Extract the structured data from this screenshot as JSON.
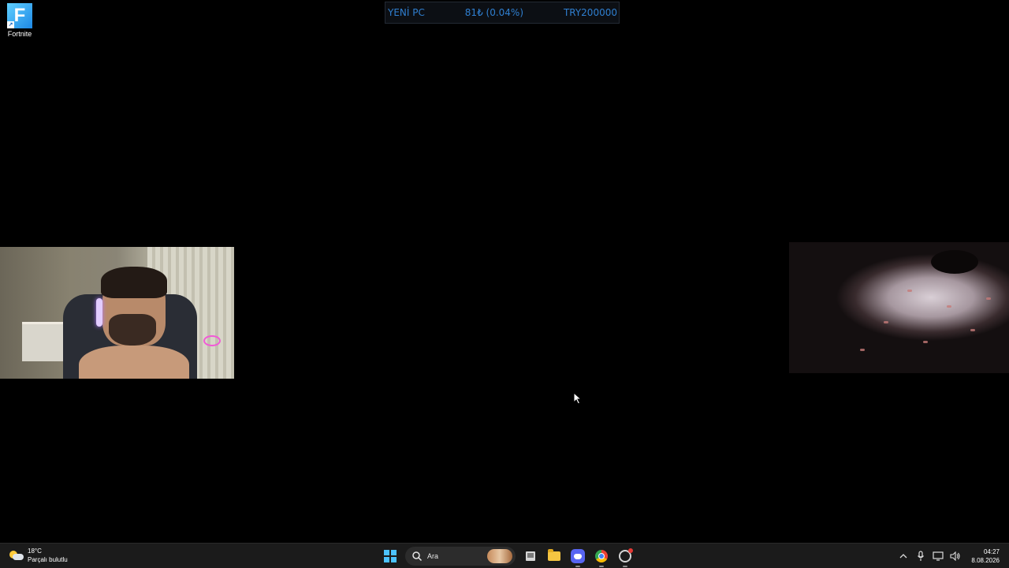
{
  "desktop": {
    "icons": [
      {
        "label": "Fortnite",
        "glyph": "F",
        "icon": "fortnite-icon"
      }
    ]
  },
  "goal_widget": {
    "title": "YENİ PC",
    "progress": "81₺ (0.04%)",
    "target": "TRY200000",
    "color": "#2f7fd0"
  },
  "overlays": {
    "webcam": "webcam-feed",
    "camera": "camera-feed"
  },
  "taskbar": {
    "weather": {
      "temp": "18°C",
      "condition": "Parçalı bulutlu",
      "icon": "partly-cloudy-icon"
    },
    "search_placeholder": "Ara",
    "apps": [
      "start-icon",
      "search-icon",
      "task-view-icon",
      "file-explorer-icon",
      "discord-icon",
      "chrome-icon",
      "obs-icon"
    ],
    "tray_icons": [
      "chevron-up-icon",
      "microphone-icon",
      "display-icon",
      "volume-icon"
    ],
    "clock": {
      "time": "04:27",
      "date": "8.08.2026"
    }
  }
}
